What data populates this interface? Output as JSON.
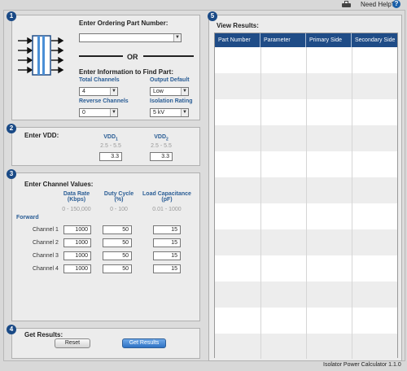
{
  "header": {
    "help_label": "Need Help?",
    "help_glyph": "?"
  },
  "footer": {
    "version": "Isolator Power Calculator 1.1.0"
  },
  "section1": {
    "number": "1",
    "title": "Enter Ordering Part Number:",
    "part_number_value": "",
    "or_label": "OR",
    "find_title": "Enter Information to Find Part:",
    "total_channels_label": "Total Channels",
    "total_channels_value": "4",
    "output_default_label": "Output Default",
    "output_default_value": "Low",
    "reverse_channels_label": "Reverse Channels",
    "reverse_channels_value": "0",
    "isolation_rating_label": "Isolation Rating",
    "isolation_rating_value": "5 kV"
  },
  "section2": {
    "number": "2",
    "title": "Enter VDD:",
    "vdd1_label": "VDD",
    "vdd1_sub": "1",
    "vdd1_range": "2.5 - 5.5",
    "vdd1_value": "3.3",
    "vdd2_label": "VDD",
    "vdd2_sub": "2",
    "vdd2_range": "2.5 - 5.5",
    "vdd2_value": "3.3"
  },
  "section3": {
    "number": "3",
    "title": "Enter Channel Values:",
    "col_data_rate": [
      "Data Rate",
      "(Kbps)"
    ],
    "col_duty_cycle": [
      "Duty Cycle",
      "(%)"
    ],
    "col_load_cap": [
      "Load Capacitance",
      "(pF)"
    ],
    "range_data_rate": "0 - 150,000",
    "range_duty_cycle": "0 - 100",
    "range_load_cap": "0.01 - 1000",
    "forward_label": "Forward",
    "channels": [
      {
        "name": "Channel 1",
        "data_rate": "1000",
        "duty_cycle": "50",
        "load_cap": "15"
      },
      {
        "name": "Channel 2",
        "data_rate": "1000",
        "duty_cycle": "50",
        "load_cap": "15"
      },
      {
        "name": "Channel 3",
        "data_rate": "1000",
        "duty_cycle": "50",
        "load_cap": "15"
      },
      {
        "name": "Channel 4",
        "data_rate": "1000",
        "duty_cycle": "50",
        "load_cap": "15"
      }
    ]
  },
  "section4": {
    "number": "4",
    "title": "Get Results:",
    "reset_label": "Reset",
    "get_results_label": "Get Results"
  },
  "section5": {
    "number": "5",
    "title": "View Results:",
    "columns": [
      "Part Number",
      "Parameter",
      "Primary Side",
      "Secondary Side"
    ]
  },
  "colors": {
    "accent": "#1f4c87",
    "label_blue": "#2a5d95",
    "button_blue": "#2e72c4"
  }
}
